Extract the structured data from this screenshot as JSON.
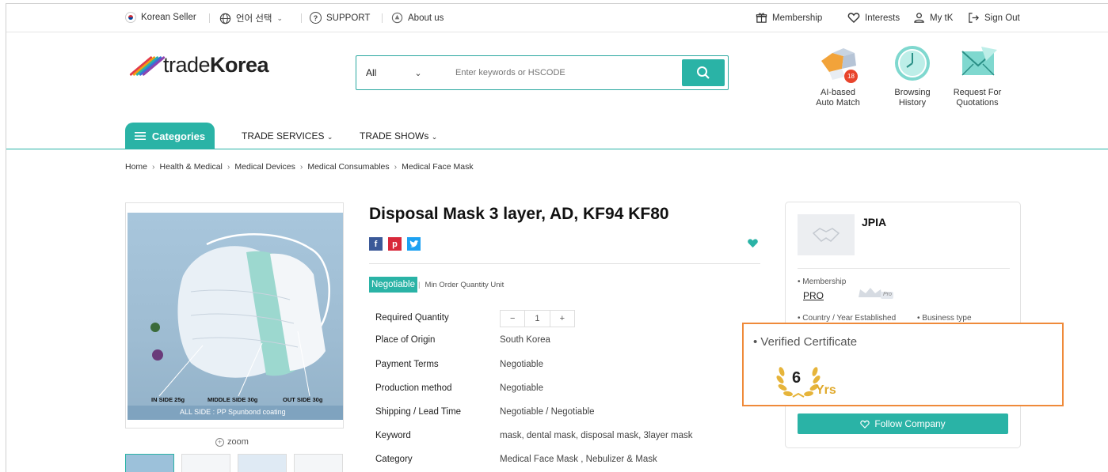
{
  "topbar": {
    "korean_seller": "Korean Seller",
    "language": "언어 선택",
    "support": "SUPPORT",
    "about": "About us",
    "membership": "Membership",
    "interests": "Interests",
    "mytk": "My tK",
    "signout": "Sign Out"
  },
  "logo": {
    "text_light": "trade",
    "text_bold": "Korea"
  },
  "search": {
    "category": "All",
    "placeholder": "Enter keywords or HSCODE"
  },
  "quick_links": [
    {
      "line1": "AI-based",
      "line2": "Auto Match",
      "badge": "18",
      "icon": "auto-match-icon"
    },
    {
      "line1": "Browsing",
      "line2": "History",
      "icon": "clock-icon"
    },
    {
      "line1": "Request For",
      "line2": "Quotations",
      "icon": "envelope-icon"
    }
  ],
  "nav": {
    "categories": "Categories",
    "trade_services": "TRADE SERVICES",
    "trade_shows": "TRADE SHOWs"
  },
  "breadcrumb": [
    "Home",
    "Health & Medical",
    "Medical Devices",
    "Medical Consumables",
    "Medical Face Mask"
  ],
  "product": {
    "title": "Disposal Mask 3 layer, AD, KF94 KF80",
    "image_labels": {
      "inside": "IN SIDE 25g",
      "middle": "MIDDLE SIDE 30g",
      "outside": "OUT SIDE 30g",
      "all_side": "ALL SIDE : PP Spunbond coating"
    },
    "zoom": "zoom",
    "price_badge": "Negotiable",
    "moq": "Min Order Quantity Unit",
    "quantity": "1",
    "specs": [
      {
        "label": "Required Quantity",
        "value": ""
      },
      {
        "label": "Place of Origin",
        "value": "South Korea"
      },
      {
        "label": "Payment Terms",
        "value": "Negotiable"
      },
      {
        "label": "Production method",
        "value": "Negotiable"
      },
      {
        "label": "Shipping / Lead Time",
        "value": "Negotiable / Negotiable"
      },
      {
        "label": "Keyword",
        "value": "mask, dental mask, disposal mask, 3layer mask"
      },
      {
        "label": "Category",
        "value": "Medical Face Mask , Nebulizer & Mask"
      }
    ]
  },
  "seller": {
    "name": "JPIA",
    "membership_label": "• Membership",
    "membership_value": "PRO",
    "crown_text": "Pro",
    "country_label": "• Country / Year Established",
    "business_label": "• Business type",
    "follow": "Follow Company"
  },
  "certificate": {
    "title": "• Verified Certificate",
    "years": "6",
    "unit": "Yrs"
  },
  "colors": {
    "accent": "#2ab3a6",
    "highlight_border": "#ef8a3a",
    "gold": "#e0a92b"
  }
}
